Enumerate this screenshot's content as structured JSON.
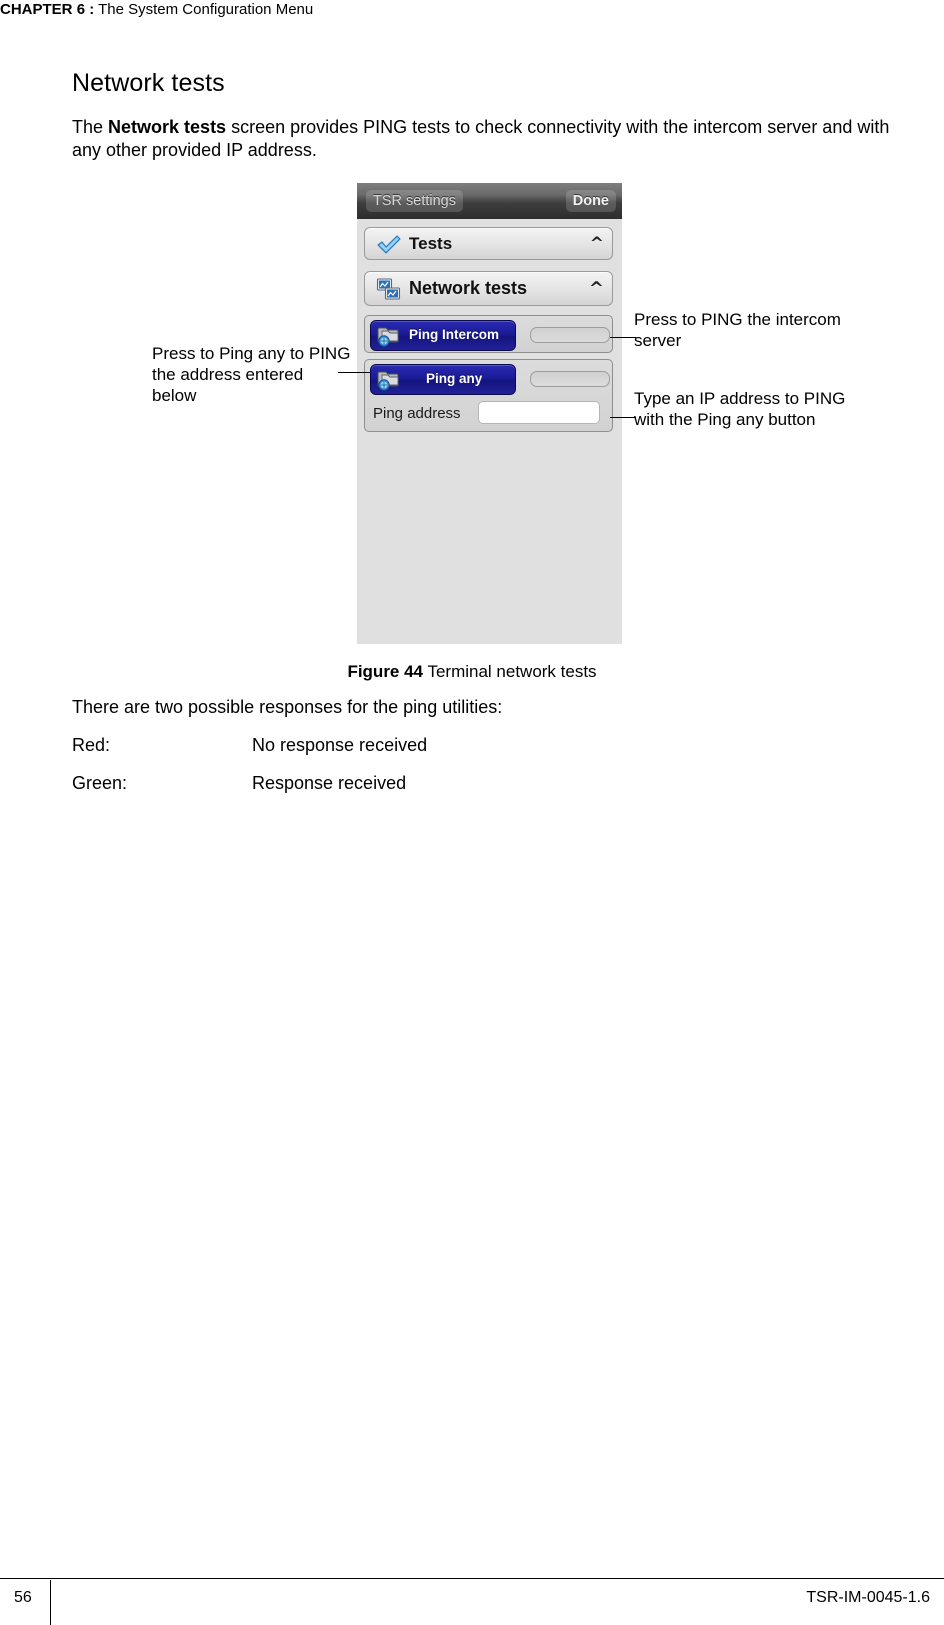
{
  "header": {
    "chapter_label": "CHAPTER",
    "chapter_number": "6 :",
    "chapter_title": "The System Configuration Menu"
  },
  "section": {
    "title": "Network tests",
    "intro_before": "The ",
    "intro_bold": "Network tests",
    "intro_after": " screen provides PING tests to check connectivity with the intercom server and with any other provided IP address."
  },
  "device": {
    "titlebar": {
      "back_label": "TSR settings",
      "done_label": "Done"
    },
    "rows": [
      {
        "label": "Tests",
        "chevron": "^",
        "icon": "checkmark-icon"
      },
      {
        "label": "Network tests",
        "chevron": "^",
        "icon": "network-monitor-icon"
      }
    ],
    "ping_intercom": {
      "button_label": "Ping Intercom",
      "icon": "network-ping-icon"
    },
    "ping_any": {
      "button_label": "Ping any",
      "icon": "network-ping-icon"
    },
    "ping_address": {
      "label": "Ping address",
      "value": "",
      "placeholder": ""
    }
  },
  "callouts": {
    "left_1": "Press to Ping any to PING the address entered below",
    "right_1": "Press to PING the intercom server",
    "right_2": "Type an IP address to PING with the Ping any button"
  },
  "figure": {
    "number_label": "Figure 44",
    "caption": " Terminal network tests"
  },
  "responses": {
    "intro": "There are two possible responses for the ping utilities:",
    "rows": [
      {
        "term": "Red:",
        "desc": "No response received"
      },
      {
        "term": "Green:",
        "desc": "Response received"
      }
    ]
  },
  "footer": {
    "page_number": "56",
    "document_id": "TSR-IM-0045-1.6"
  },
  "colors": {
    "ping_button_blue": "#1b1b96",
    "device_background": "#e0e0e0",
    "titlebar_dark": "#3d3d3d"
  }
}
